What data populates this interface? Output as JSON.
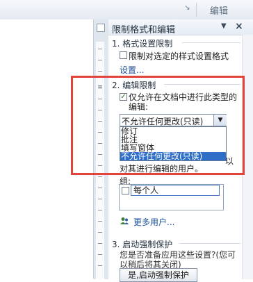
{
  "ribbon": {
    "group_label": "编辑",
    "launcher_icon": "dialog-launcher-icon"
  },
  "pane": {
    "title": "限制格式和编辑",
    "menu_glyph": "▼",
    "close_glyph": "×",
    "sec1": {
      "title": "1. 格式设置限制",
      "checkbox_label": "限制对选定的样式设置格式",
      "checked": false,
      "settings_link": "设置..."
    },
    "sec2": {
      "title": "2. 编辑限制",
      "checkbox_label_1": "仅允许在文档中进行此类型的",
      "checkbox_label_2": "编辑:",
      "checked": true,
      "dropdown_value": "不允许任何更改(只读)",
      "dropdown_options": [
        "修订",
        "批注",
        "填写窗体",
        "不允许任何更改(只读)"
      ],
      "selected_option": "不允许任何更改(只读)",
      "exceptions_tail": "以",
      "exceptions_line2": "对其进行编辑的用户。",
      "group_label": "组:",
      "everyone_label": "每个人",
      "everyone_checked": false,
      "more_users": "更多用户..."
    },
    "sec3": {
      "title": "3. 启动强制保护",
      "question_1": "您是否准备应用这些设置?(您可",
      "question_2": "以稍后将其关闭)",
      "enforce_button": "是,启动强制保护"
    }
  },
  "colors": {
    "highlight": "#e0443a",
    "selection": "#2f6fc7",
    "link": "#1e4f9c"
  }
}
